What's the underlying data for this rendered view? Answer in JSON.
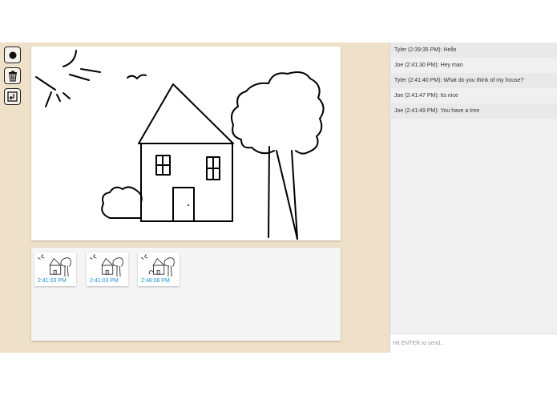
{
  "toolbar": {
    "tools": [
      {
        "name": "record-button",
        "icon": "record-icon"
      },
      {
        "name": "delete-button",
        "icon": "trash-icon"
      },
      {
        "name": "save-button",
        "icon": "save-arrow-icon"
      }
    ]
  },
  "gallery": {
    "snapshots": [
      {
        "time": "2:41:03 PM"
      },
      {
        "time": "2:41:03 PM"
      },
      {
        "time": "2:48:08 PM"
      }
    ]
  },
  "chat": {
    "messages": [
      "Tyler (2:39:35 PM): Hello",
      "Joe (2:41:30 PM): Hey man",
      "Tyler (2:41:40 PM): What do you think of my house?",
      "Joe (2:41:47 PM): Its nice",
      "Joe (2:41:49 PM): You have a tree"
    ],
    "input_placeholder": "Hit ENTER to send..."
  },
  "colors": {
    "background": "#efe0c9",
    "timestamp": "#1a8fd1"
  }
}
